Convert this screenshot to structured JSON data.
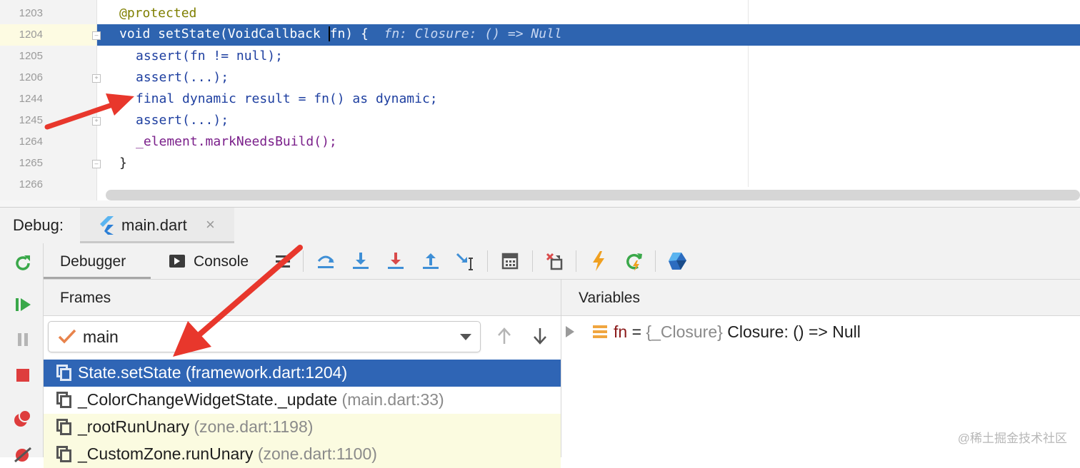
{
  "editor": {
    "lines": [
      {
        "num": "1203",
        "code": "@protected"
      },
      {
        "num": "1204",
        "code_prefix": "void setState(VoidCallback ",
        "code_param": "fn",
        "code_suffix": ") {",
        "hint": "fn: Closure: () => Null"
      },
      {
        "num": "1205",
        "code": "assert(fn != null);"
      },
      {
        "num": "1206",
        "code": "assert(...);"
      },
      {
        "num": "1244",
        "code": "final dynamic result = fn() as dynamic;"
      },
      {
        "num": "1245",
        "code": "assert(...);"
      },
      {
        "num": "1264",
        "code": "_element.markNeedsBuild();"
      },
      {
        "num": "1265",
        "code": "}"
      },
      {
        "num": "1266",
        "code": ""
      }
    ]
  },
  "debug_bar": {
    "label": "Debug:",
    "run_tab": "main.dart",
    "close": "×"
  },
  "tabs": {
    "debugger": "Debugger",
    "console": "Console"
  },
  "frames": {
    "header": "Frames",
    "thread": "main",
    "rows": [
      {
        "method": "State.setState",
        "location": "(framework.dart:1204)"
      },
      {
        "method": "_ColorChangeWidgetState._update",
        "location": "(main.dart:33)"
      },
      {
        "method": "_rootRunUnary",
        "location": "(zone.dart:1198)"
      },
      {
        "method": "_CustomZone.runUnary",
        "location": "(zone.dart:1100)"
      }
    ]
  },
  "variables": {
    "header": "Variables",
    "row": {
      "name": "fn",
      "eq": "=",
      "type": "{_Closure}",
      "value": "Closure: () => Null"
    }
  },
  "watermark": "@稀土掘金技术社区",
  "colors": {
    "selection": "#2f65b5",
    "arrow": "#e8372c"
  }
}
